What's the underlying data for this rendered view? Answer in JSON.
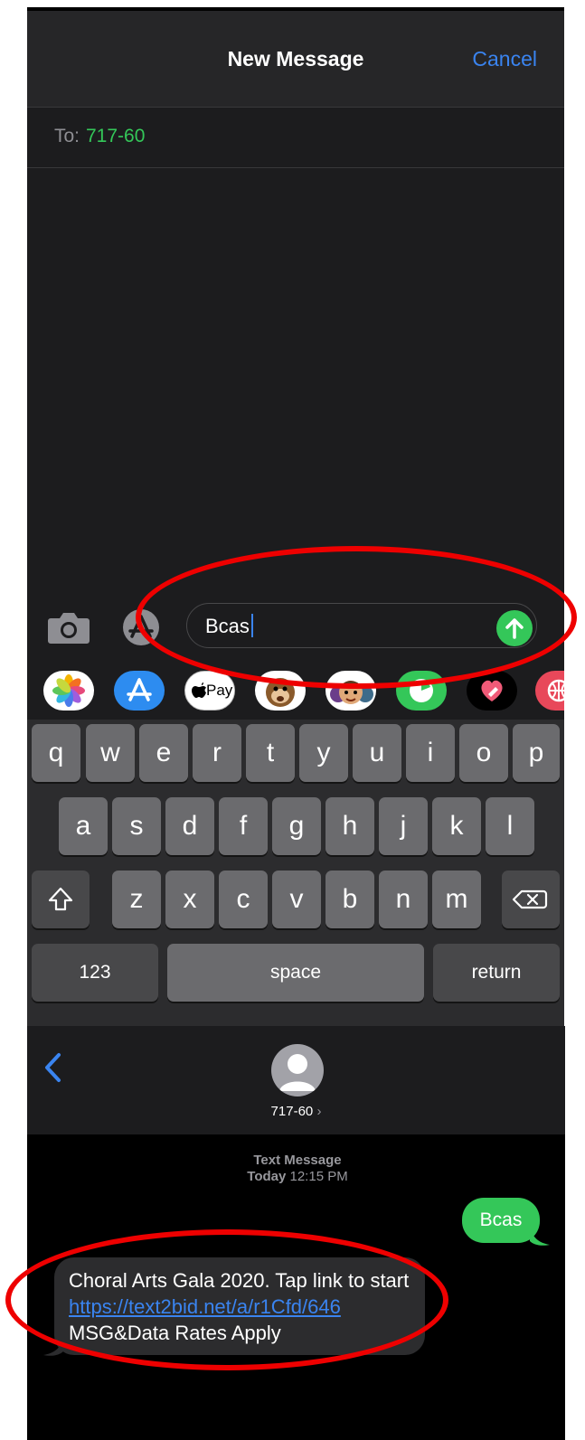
{
  "compose": {
    "title": "New Message",
    "cancel_label": "Cancel",
    "to_label": "To:",
    "to_value": "717-60",
    "message_text": "Bcas"
  },
  "app_strip": {
    "apple_pay_label": "Pay",
    "icons": [
      "photos-icon",
      "app-store-icon",
      "apple-pay-icon",
      "memoji-monkey-icon",
      "memoji-stickers-icon",
      "activity-icon",
      "digital-touch-icon",
      "web-search-icon"
    ]
  },
  "keyboard": {
    "row1": [
      "q",
      "w",
      "e",
      "r",
      "t",
      "y",
      "u",
      "i",
      "o",
      "p"
    ],
    "row2": [
      "a",
      "s",
      "d",
      "f",
      "g",
      "h",
      "j",
      "k",
      "l"
    ],
    "row3": [
      "z",
      "x",
      "c",
      "v",
      "b",
      "n",
      "m"
    ],
    "numbers_label": "123",
    "space_label": "space",
    "return_label": "return"
  },
  "thread": {
    "contact_name": "717-60",
    "contact_chevron": "›",
    "service_label": "Text Message",
    "date_label": "Today",
    "time_label": "12:15 PM",
    "outgoing_message": "Bcas",
    "incoming_message_prefix": "Choral Arts Gala 2020. Tap link to start ",
    "incoming_link": "https://text2bid.net/a/r1Cfd/646",
    "incoming_message_suffix": " MSG&Data Rates Apply"
  },
  "colors": {
    "ios_blue": "#3a84f0",
    "ios_green": "#34c759",
    "annotation_red": "#ee0000"
  }
}
